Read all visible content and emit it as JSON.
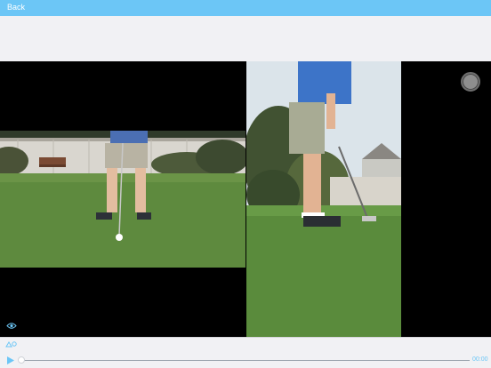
{
  "header": {
    "back_label": "Back"
  },
  "player": {
    "time": "00:00",
    "progress": 0
  },
  "icons": {
    "eye": "eye-icon",
    "draw": "draw-tool-icon",
    "play": "play-icon",
    "record": "record-icon"
  },
  "colors": {
    "accent": "#6cc6f6",
    "stage": "#000000"
  }
}
